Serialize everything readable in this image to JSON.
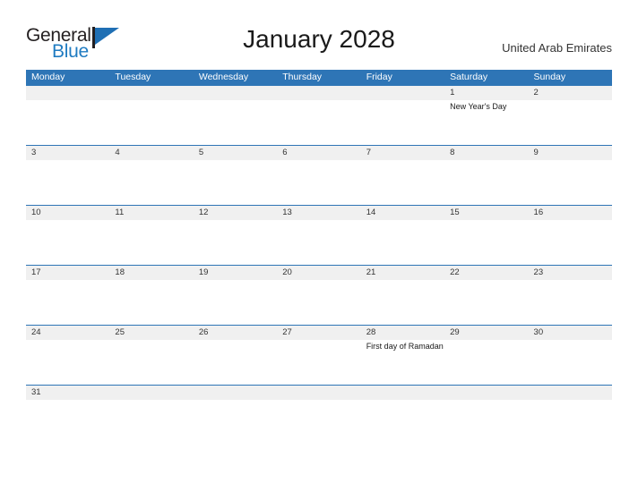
{
  "branding": {
    "logo_text_top": "General",
    "logo_text_bottom": "Blue",
    "logo_mark": "flag-triangle-icon"
  },
  "header": {
    "title": "January 2028",
    "country": "United Arab Emirates"
  },
  "colors": {
    "header_blue": "#2e75b6",
    "row_rule_blue": "#2e75b6",
    "day_band_gray": "#f0f0f0",
    "logo_blue": "#1f7bc1",
    "text_dark": "#231f20"
  },
  "calendar": {
    "weekdays": [
      "Monday",
      "Tuesday",
      "Wednesday",
      "Thursday",
      "Friday",
      "Saturday",
      "Sunday"
    ],
    "weeks": [
      {
        "days": [
          {
            "num": "",
            "event": ""
          },
          {
            "num": "",
            "event": ""
          },
          {
            "num": "",
            "event": ""
          },
          {
            "num": "",
            "event": ""
          },
          {
            "num": "",
            "event": ""
          },
          {
            "num": "1",
            "event": "New Year's Day"
          },
          {
            "num": "2",
            "event": ""
          }
        ]
      },
      {
        "days": [
          {
            "num": "3",
            "event": ""
          },
          {
            "num": "4",
            "event": ""
          },
          {
            "num": "5",
            "event": ""
          },
          {
            "num": "6",
            "event": ""
          },
          {
            "num": "7",
            "event": ""
          },
          {
            "num": "8",
            "event": ""
          },
          {
            "num": "9",
            "event": ""
          }
        ]
      },
      {
        "days": [
          {
            "num": "10",
            "event": ""
          },
          {
            "num": "11",
            "event": ""
          },
          {
            "num": "12",
            "event": ""
          },
          {
            "num": "13",
            "event": ""
          },
          {
            "num": "14",
            "event": ""
          },
          {
            "num": "15",
            "event": ""
          },
          {
            "num": "16",
            "event": ""
          }
        ]
      },
      {
        "days": [
          {
            "num": "17",
            "event": ""
          },
          {
            "num": "18",
            "event": ""
          },
          {
            "num": "19",
            "event": ""
          },
          {
            "num": "20",
            "event": ""
          },
          {
            "num": "21",
            "event": ""
          },
          {
            "num": "22",
            "event": ""
          },
          {
            "num": "23",
            "event": ""
          }
        ]
      },
      {
        "days": [
          {
            "num": "24",
            "event": ""
          },
          {
            "num": "25",
            "event": ""
          },
          {
            "num": "26",
            "event": ""
          },
          {
            "num": "27",
            "event": ""
          },
          {
            "num": "28",
            "event": "First day of Ramadan"
          },
          {
            "num": "29",
            "event": ""
          },
          {
            "num": "30",
            "event": ""
          }
        ]
      },
      {
        "days": [
          {
            "num": "31",
            "event": ""
          },
          {
            "num": "",
            "event": ""
          },
          {
            "num": "",
            "event": ""
          },
          {
            "num": "",
            "event": ""
          },
          {
            "num": "",
            "event": ""
          },
          {
            "num": "",
            "event": ""
          },
          {
            "num": "",
            "event": ""
          }
        ]
      }
    ]
  }
}
